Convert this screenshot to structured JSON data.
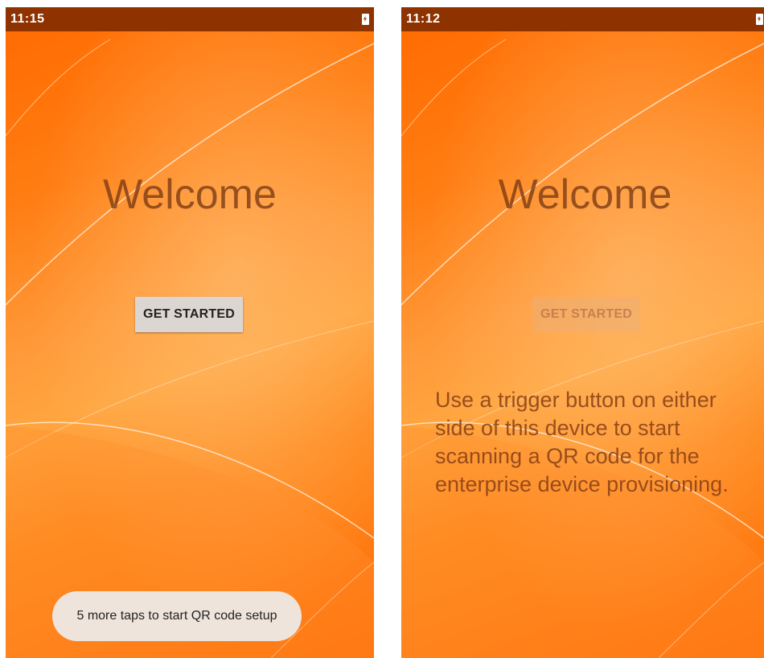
{
  "left_screen": {
    "status_bar": {
      "time": "11:15",
      "battery_icon": "battery-charging-icon"
    },
    "welcome_title": "Welcome",
    "get_started_label": "GET STARTED",
    "toast_message": "5 more taps to start QR code setup"
  },
  "right_screen": {
    "status_bar": {
      "time": "11:12",
      "battery_icon": "battery-charging-icon"
    },
    "welcome_title": "Welcome",
    "get_started_label": "GET STARTED",
    "hint_text": "Use a trigger button on either side of this device to start scanning a QR code for the enterprise device provisioning."
  },
  "colors": {
    "status_bar_bg": "#8e3200",
    "wallpaper_orange": "#ff7d12",
    "title_text": "#7a3a12",
    "button_bg": "#dcd6d2",
    "toast_bg": "#efe4dc"
  }
}
